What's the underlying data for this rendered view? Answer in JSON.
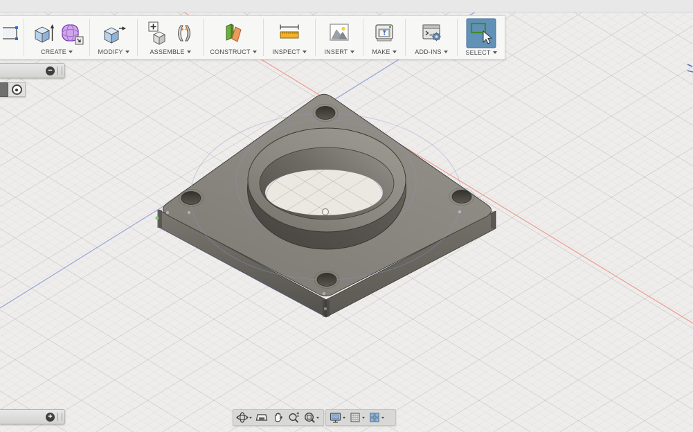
{
  "window": {
    "top_strip_color": "#e9e8e8",
    "toolbar_background": "#f7f7f6"
  },
  "toolbar": {
    "groups": [
      {
        "id": "sketch-stub",
        "label": ""
      },
      {
        "id": "create",
        "label": "CREATE"
      },
      {
        "id": "modify",
        "label": "MODIFY"
      },
      {
        "id": "assemble",
        "label": "ASSEMBLE"
      },
      {
        "id": "construct",
        "label": "CONSTRUCT"
      },
      {
        "id": "inspect",
        "label": "INSPECT"
      },
      {
        "id": "insert",
        "label": "INSERT"
      },
      {
        "id": "make",
        "label": "MAKE"
      },
      {
        "id": "addins",
        "label": "ADD-INS"
      },
      {
        "id": "select",
        "label": "SELECT"
      }
    ],
    "icons": [
      "sketch-rectangle",
      "extrude",
      "create-form",
      "press-pull",
      "new-component",
      "joint",
      "construction-plane",
      "measure",
      "insert-image",
      "3d-print",
      "scripts-addins",
      "select-window"
    ]
  },
  "panels": {
    "browser_bar": {
      "collapse_glyph": "−"
    },
    "browser_item": {
      "icon": "radio-origin"
    },
    "timeline_bar": {
      "expand_glyph": "+"
    }
  },
  "navbar": {
    "left_icons": [
      "orbit",
      "look-at",
      "pan",
      "zoom",
      "zoom-fit"
    ],
    "right_icons": [
      "display-settings",
      "layout-grid",
      "viewports"
    ]
  },
  "canvas": {
    "background": "#eeedeb",
    "grid_major_color": "rgba(100,100,100,0.13)",
    "grid_minor_color": "rgba(100,100,100,0.05)",
    "axes": {
      "x_color": "#ee9a90",
      "z_color": "#9aa3d8"
    },
    "part": {
      "description": "square flange plate with center ring boss and 4 corner holes",
      "top_face": "#8a8780",
      "side_left": "#6f6c66",
      "side_right": "#67645e",
      "ring_rim": "#8c8982",
      "ring_wall": "#4e4c47",
      "ring_inner": "#6e6b64",
      "hole": "#3a3833",
      "hole_floor": "#ebe8e2",
      "sketch_blue": "#8d96cc",
      "vertex_green": "#7cc47f"
    }
  }
}
